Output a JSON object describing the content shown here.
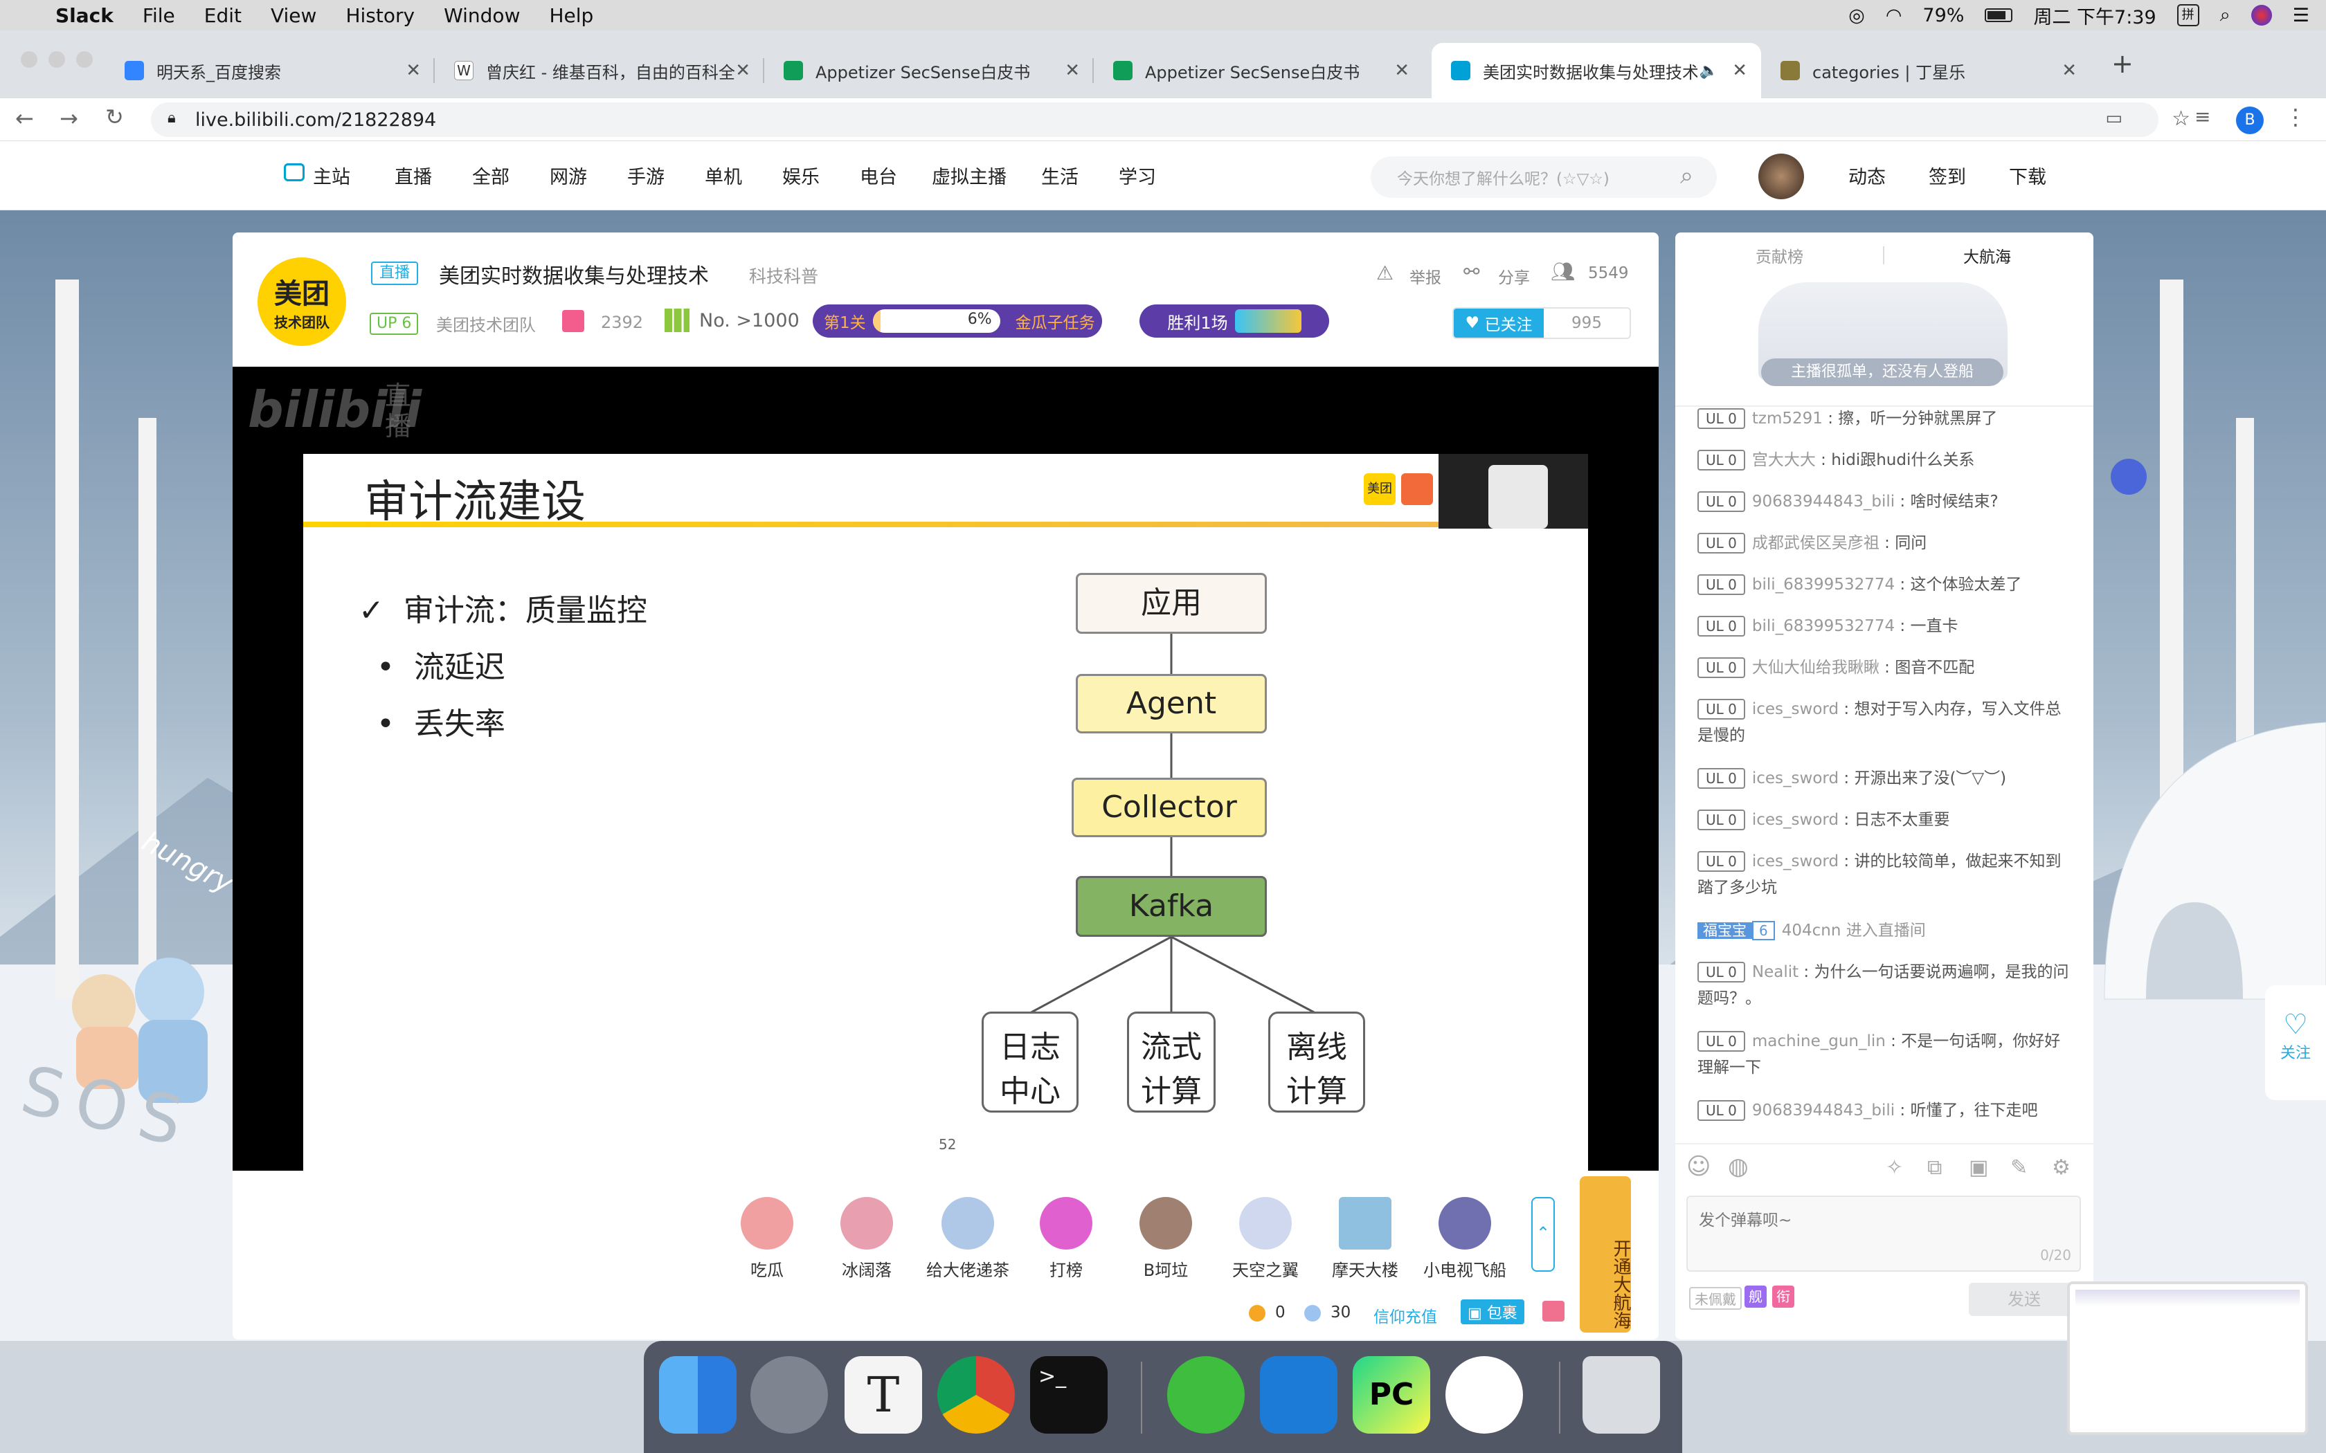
{
  "menubar": {
    "app": "Slack",
    "items": [
      "File",
      "Edit",
      "View",
      "History",
      "Window",
      "Help"
    ],
    "battery": "79%",
    "clock": "周二 下午7:39"
  },
  "tabs": [
    {
      "title": "明天系_百度搜索",
      "color": "#3385ff"
    },
    {
      "title": "曾庆红 - 维基百科，自由的百科全",
      "color": "#ffffff"
    },
    {
      "title": "Appetizer SecSense白皮书",
      "color": "#0f9d58"
    },
    {
      "title": "Appetizer SecSense白皮书",
      "color": "#0f9d58"
    },
    {
      "title": "美团实时数据收集与处理技术",
      "color": "#00a1d6"
    },
    {
      "title": "categories | 丁星乐",
      "color": "#8a7a3a"
    }
  ],
  "address": "live.bilibili.com/21822894",
  "profile_initial": "B",
  "bili_nav": {
    "items": [
      "主站",
      "直播",
      "全部",
      "网游",
      "手游",
      "单机",
      "娱乐",
      "电台",
      "虚拟主播",
      "生活",
      "学习"
    ],
    "search_placeholder": "今天你想了解什么呢？(☆▽☆)",
    "right": [
      "动态",
      "签到",
      "下载"
    ]
  },
  "room": {
    "logo_line1": "美团",
    "logo_line2": "技术团队",
    "live_badge": "直播",
    "title": "美团实时数据收集与处理技术",
    "category": "科技科普",
    "up_level": "UP 6",
    "host": "美团技术团队",
    "gifts_count": "2392",
    "rank": "No. >1000",
    "task_stage": "第1关",
    "task_progress": 0.06,
    "task_percent": "6%",
    "task_name": "金瓜子任务",
    "win_label": "胜利1场",
    "report": "举报",
    "share": "分享",
    "viewers": "5549",
    "follow_label": "已关注",
    "followers": "995"
  },
  "slide": {
    "watermark1": "bilibili",
    "watermark2": "直播",
    "title": "审计流建设",
    "bullet_main": "审计流：质量监控",
    "bullets": [
      "流延迟",
      "丢失率"
    ],
    "nodes": [
      "应用",
      "Agent",
      "Collector",
      "Kafka"
    ],
    "leaves": [
      [
        "日志",
        "中心"
      ],
      [
        "流式",
        "计算"
      ],
      [
        "离线",
        "计算"
      ]
    ],
    "page": "52",
    "brand": "美团"
  },
  "gifts": [
    "吃瓜",
    "冰阔落",
    "给大佬递茶",
    "打榜",
    "B坷垃",
    "天空之翼",
    "摩天大楼",
    "小电视飞船"
  ],
  "wallet": {
    "gold": "0",
    "silver": "30",
    "recharge": "信仰充值",
    "bag": "包裹",
    "captain": "开通大航海"
  },
  "panel": {
    "tabs": [
      "贡献榜",
      "大航海"
    ],
    "guard_text": "主播很孤单，还没有人登船",
    "chat": [
      {
        "lvl": "UL 0",
        "name": "tzm5291",
        "msg": "擦，听一分钟就黑屏了"
      },
      {
        "lvl": "UL 0",
        "name": "宫大大大",
        "msg": "hidi跟hudi什么关系"
      },
      {
        "lvl": "UL 0",
        "name": "90683944843_bili",
        "msg": "啥时候结束?"
      },
      {
        "lvl": "UL 0",
        "name": "成都武侯区吴彦祖",
        "msg": "同问"
      },
      {
        "lvl": "UL 0",
        "name": "bili_68399532774",
        "msg": "这个体验太差了"
      },
      {
        "lvl": "UL 0",
        "name": "bili_68399532774",
        "msg": "一直卡"
      },
      {
        "lvl": "UL 0",
        "name": "大仙大仙给我瞅瞅",
        "msg": "图音不匹配"
      },
      {
        "lvl": "UL 0",
        "name": "ices_sword",
        "msg": "想对于写入内存，写入文件总是慢的"
      },
      {
        "lvl": "UL 0",
        "name": "ices_sword",
        "msg": "开源出来了没(︶▽︶)"
      },
      {
        "lvl": "UL 0",
        "name": "ices_sword",
        "msg": "日志不太重要"
      },
      {
        "lvl": "UL 0",
        "name": "ices_sword",
        "msg": "讲的比较简单，做起来不知到踏了多少坑"
      }
    ],
    "enter": {
      "badge": "福宝宝",
      "badge_lvl": "6",
      "name": "404cnn",
      "msg": "进入直播间"
    },
    "chat2": [
      {
        "lvl": "UL 0",
        "name": "Nealit",
        "msg": "为什么一句话要说两遍啊，是我的问题吗？。"
      },
      {
        "lvl": "UL 0",
        "name": "machine_gun_lin",
        "msg": "不是一句话啊，你好好理解一下"
      },
      {
        "lvl": "UL 0",
        "name": "90683944843_bili",
        "msg": "听懂了，往下走吧"
      }
    ],
    "input_placeholder": "发个弹幕呗~",
    "input_count": "0/20",
    "unworn": "未佩戴",
    "tag1": "舰",
    "tag2": "衔",
    "send": "发送",
    "follow_side": "关注"
  },
  "scene": {
    "hungry": "hungry",
    "sos": "SOS"
  }
}
